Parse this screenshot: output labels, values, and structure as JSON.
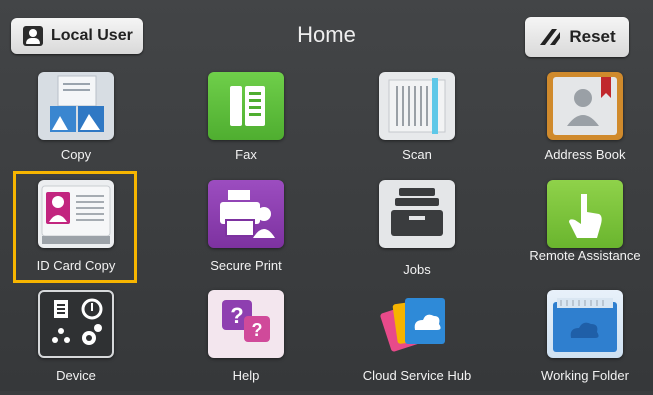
{
  "header": {
    "user_label": "Local User",
    "title": "Home",
    "reset_label": "Reset"
  },
  "apps": [
    {
      "label": "Copy"
    },
    {
      "label": "Fax"
    },
    {
      "label": "Scan"
    },
    {
      "label": "Address Book"
    },
    {
      "label": "ID Card Copy"
    },
    {
      "label": "Secure Print"
    },
    {
      "label": "Jobs"
    },
    {
      "label": "Remote Assistance"
    },
    {
      "label": "Device"
    },
    {
      "label": "Help"
    },
    {
      "label": "Cloud Service Hub"
    },
    {
      "label": "Working Folder"
    }
  ],
  "colors": {
    "selection": "#f7b500",
    "fax": "#5bbf3b",
    "secure_print": "#8e3fb0",
    "id_card": "#c2257f",
    "remote": "#7cc23a"
  }
}
